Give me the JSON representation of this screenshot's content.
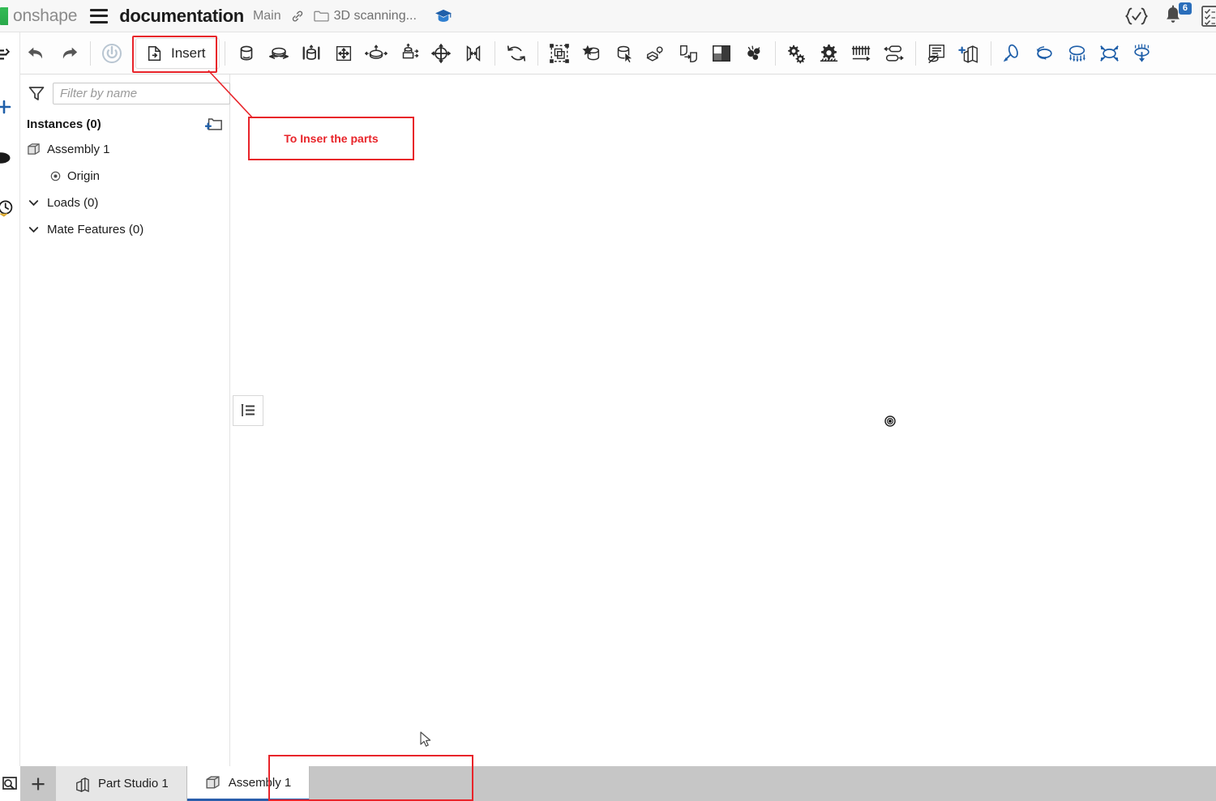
{
  "topbar": {
    "logo_text": "onshape",
    "menu_icon": "hamburger-menu-icon",
    "document_title": "documentation",
    "workspace": "Main",
    "link_icon": "link-icon",
    "folder_icon": "folder-icon",
    "folder_name": "3D scanning...",
    "learning_icon": "graduation-cap-icon",
    "right_icons": [
      {
        "name": "code-check-icon",
        "label": "{✓}"
      },
      {
        "name": "notification-bell-icon",
        "badge": "6"
      },
      {
        "name": "checklist-document-icon",
        "label": ""
      }
    ]
  },
  "toolbar": {
    "undo_label": "Undo",
    "redo_label": "Redo",
    "rebuild_label": "Rebuild",
    "insert_label": "Insert",
    "items": [
      {
        "name": "undo-icon",
        "title": "Undo"
      },
      {
        "name": "redo-icon",
        "title": "Redo"
      },
      {
        "name": "rebuild-icon",
        "title": "Rebuild",
        "disabled": true
      },
      {
        "name": "insert-button",
        "title": "Insert",
        "is_button": true
      },
      {
        "name": "mate-connector-icon",
        "title": "Mate connector"
      },
      {
        "name": "fastened-mate-icon",
        "title": "Fastened mate"
      },
      {
        "name": "revolute-mate-icon",
        "title": "Revolute mate"
      },
      {
        "name": "slider-mate-icon",
        "title": "Slider mate"
      },
      {
        "name": "planar-mate-icon",
        "title": "Planar mate"
      },
      {
        "name": "cylindrical-mate-icon",
        "title": "Cylindrical mate"
      },
      {
        "name": "pin-slot-mate-icon",
        "title": "Pin slot mate"
      },
      {
        "name": "ball-mate-icon",
        "title": "Ball mate"
      },
      {
        "name": "parallel-mate-icon",
        "title": "Parallel mate"
      },
      {
        "name": "tangent-mate-icon",
        "title": "Tangent mate"
      },
      {
        "name": "group-icon",
        "title": "Group"
      },
      {
        "name": "boolean-icon",
        "title": "Boolean"
      },
      {
        "name": "replicate-icon",
        "title": "Replicate"
      },
      {
        "name": "insert-feature-studio-icon",
        "title": "Feature studio"
      },
      {
        "name": "pattern-icon",
        "title": "Pattern"
      },
      {
        "name": "exploded-view-icon",
        "title": "Exploded view"
      },
      {
        "name": "simulation-icon",
        "title": "Simulation"
      },
      {
        "name": "gear-mate-icon",
        "title": "Gear relation"
      },
      {
        "name": "gear-relation-icon",
        "title": "Gear"
      },
      {
        "name": "rack-pinion-icon",
        "title": "Rack and pinion"
      },
      {
        "name": "linear-relation-icon",
        "title": "Linear relation"
      },
      {
        "name": "hide-show-icon",
        "title": "Show/hide"
      },
      {
        "name": "add-part-studio-icon",
        "title": "Add part studio"
      },
      {
        "name": "load-force-icon",
        "title": "Force load"
      },
      {
        "name": "load-moment-icon",
        "title": "Moment load"
      },
      {
        "name": "load-pressure-icon",
        "title": "Pressure load"
      },
      {
        "name": "load-constraint-icon",
        "title": "Constraint"
      },
      {
        "name": "load-gravity-icon",
        "title": "Gravity"
      }
    ]
  },
  "tree": {
    "filter_icon": "filter-icon",
    "filter_placeholder": "Filter by name",
    "list_view_icon": "list-view-icon",
    "instances_label": "Instances (0)",
    "add_folder_icon": "add-folder-icon",
    "nodes": [
      {
        "label": "Assembly 1",
        "icon": "assembly-icon",
        "indent": 0,
        "chevron": false
      },
      {
        "label": "Origin",
        "icon": "origin-icon",
        "indent": 1,
        "chevron": false
      },
      {
        "label": "Loads (0)",
        "icon": "",
        "indent": 0,
        "chevron": true
      },
      {
        "label": "Mate Features (0)",
        "icon": "",
        "indent": 0,
        "chevron": true
      }
    ]
  },
  "viewport": {
    "panel_toggle_icon": "list-panel-toggle-icon",
    "origin_marker_icon": "origin-point-icon",
    "cursor_icon": "mouse-cursor-icon"
  },
  "annotation": {
    "text": "To Inser the parts",
    "color": "#e8242a"
  },
  "tabbar": {
    "search_icon": "search-document-icon",
    "add_tab_label": "+",
    "tabs": [
      {
        "label": "Part Studio 1",
        "icon": "part-studio-icon",
        "active": false
      },
      {
        "label": "Assembly 1",
        "icon": "assembly-icon",
        "active": true
      }
    ]
  },
  "rail": {
    "items": [
      {
        "name": "rail-list-icon"
      },
      {
        "name": "rail-add-icon"
      },
      {
        "name": "rail-comment-icon"
      },
      {
        "name": "rail-history-icon"
      }
    ]
  },
  "colors": {
    "accent_blue": "#2a5eab",
    "highlight_red": "#e8242a",
    "brand_green": "#2aa84a",
    "toolbar_bg": "#fdfdfd",
    "tabbar_bg": "#c6c6c6"
  }
}
